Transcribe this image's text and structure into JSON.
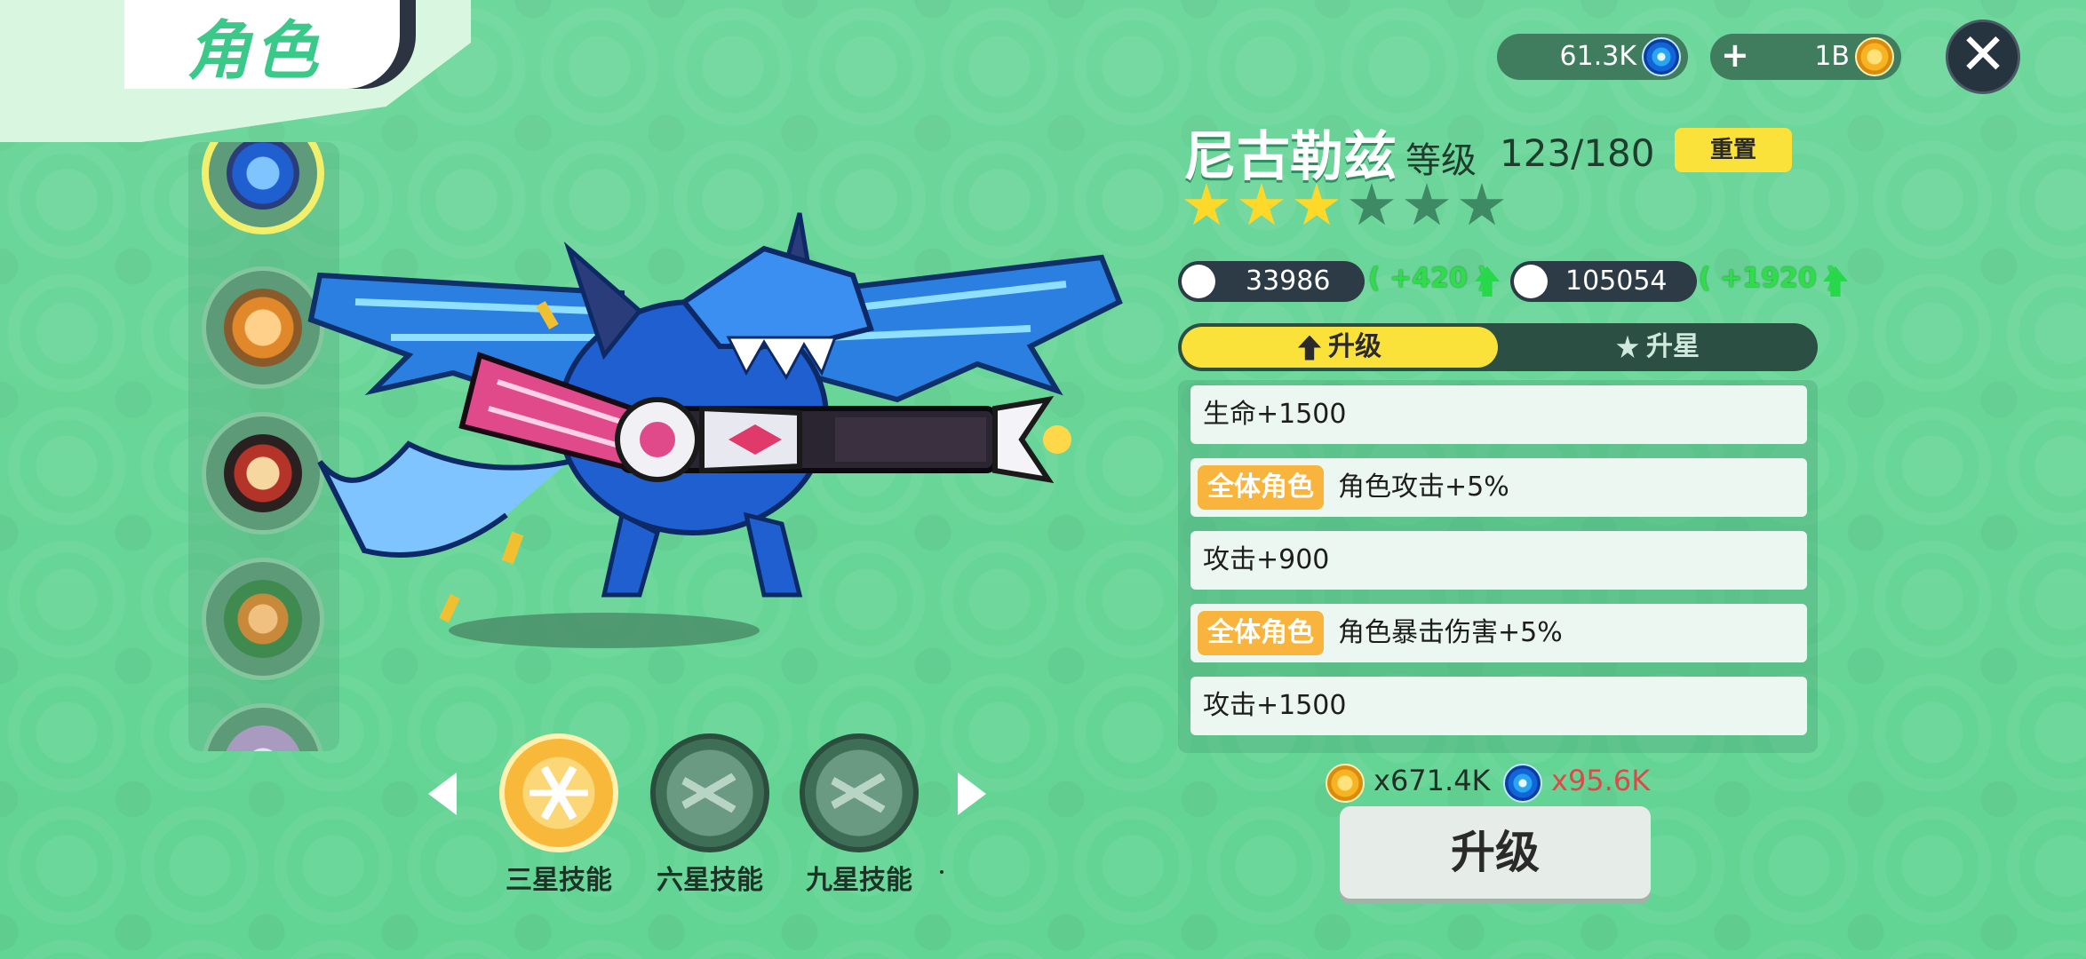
{
  "page": {
    "title": "角色"
  },
  "resources": {
    "gems": "61.3K",
    "gold": "1B",
    "plus_symbol": "+"
  },
  "close_symbol": "✕",
  "character": {
    "name": "尼古勒兹",
    "level_label": "等级",
    "level_value": "123/180",
    "reset_label": "重置",
    "stars_filled": 3,
    "stars_total": 6,
    "attack": "33986",
    "attack_bonus": "( +420 )",
    "hp": "105054",
    "hp_bonus": "( +1920 )"
  },
  "tabs": {
    "upgrade": "升级",
    "star_up": "升星"
  },
  "upgrades": [
    {
      "badge": "",
      "text": "生命+1500"
    },
    {
      "badge": "全体角色",
      "text": "角色攻击+5%"
    },
    {
      "badge": "",
      "text": "攻击+900"
    },
    {
      "badge": "全体角色",
      "text": "角色暴击伤害+5%"
    },
    {
      "badge": "",
      "text": "攻击+1500"
    }
  ],
  "cost": {
    "gold": "x671.4K",
    "gems": "x95.6K"
  },
  "upgrade_button": "升级",
  "skills": [
    {
      "label": "三星技能",
      "active": true
    },
    {
      "label": "六星技能",
      "active": false
    },
    {
      "label": "九星技能",
      "active": false
    }
  ],
  "character_list": [
    {
      "name": "ice-dragon",
      "selected": true
    },
    {
      "name": "orange-dragon",
      "selected": false
    },
    {
      "name": "caped-hamster",
      "selected": false
    },
    {
      "name": "crocodile-rider",
      "selected": false
    },
    {
      "name": "partial-character",
      "selected": false
    }
  ],
  "colors": {
    "background": "#68d89a",
    "accent_yellow": "#fbe23a",
    "badge_orange": "#f8b43c",
    "bonus_green": "#2fdd4a",
    "cost_gem_red": "#e04848"
  }
}
